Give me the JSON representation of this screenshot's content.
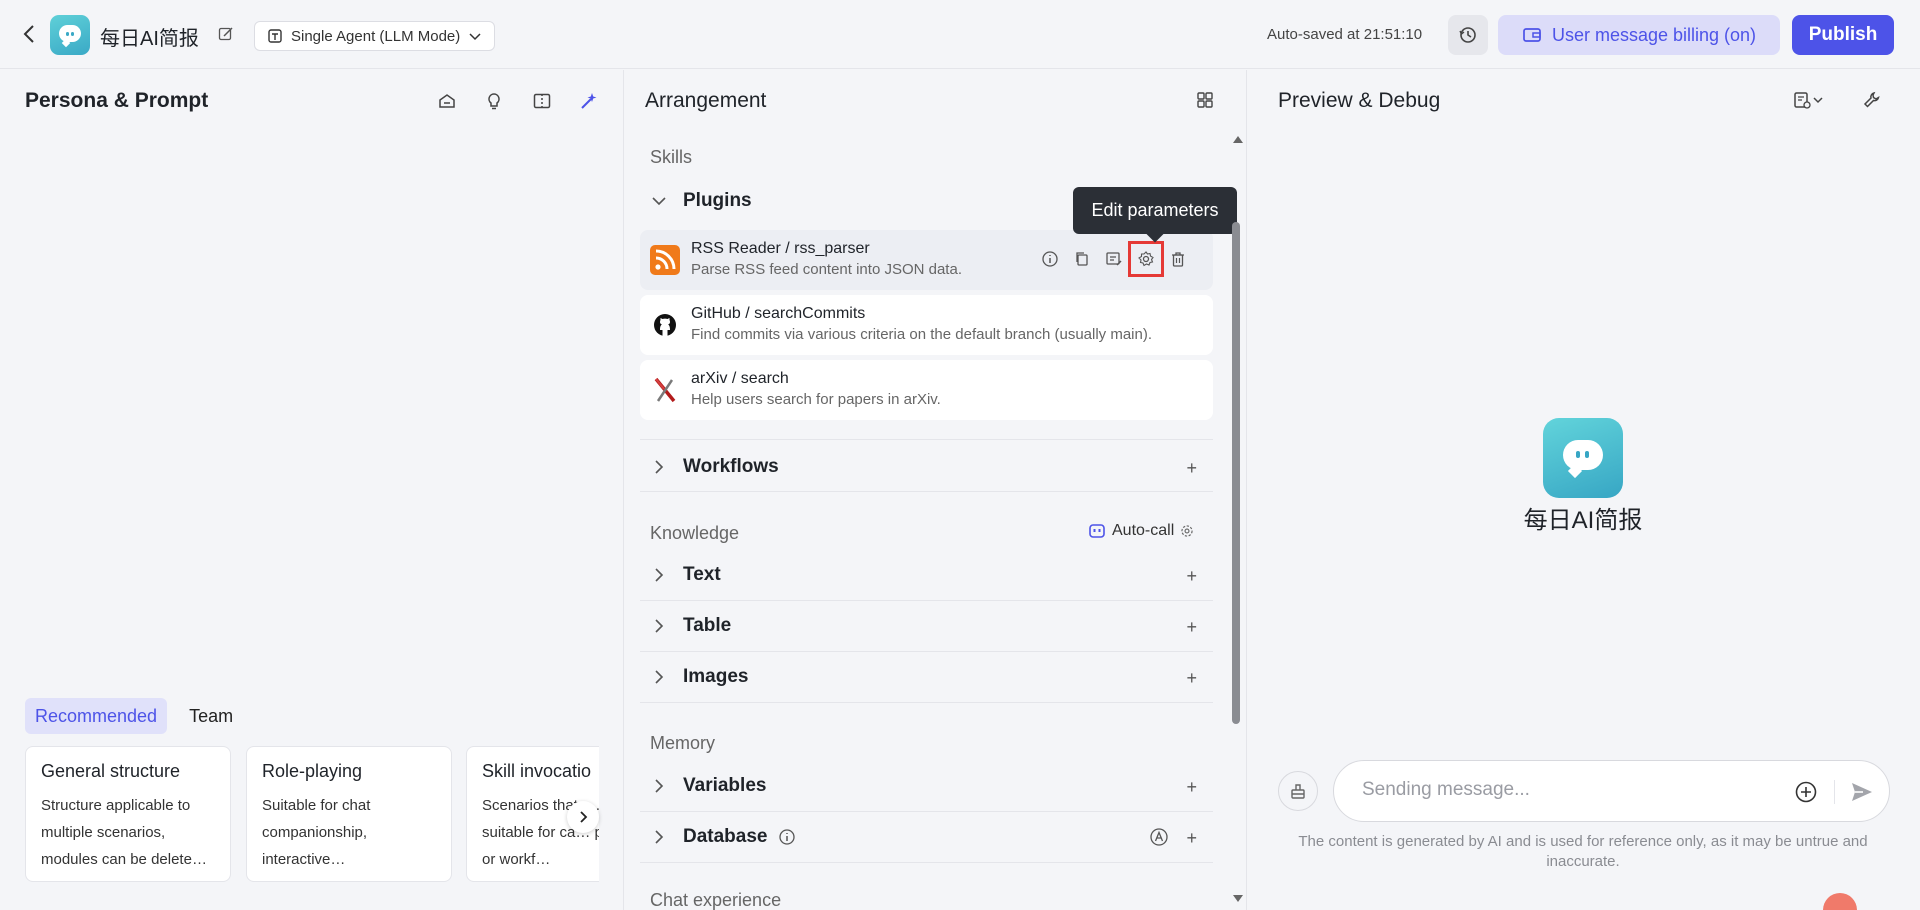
{
  "header": {
    "app_title": "每日AI简报",
    "mode_label": "Single Agent (LLM Mode)",
    "autosave_text": "Auto-saved at 21:51:10",
    "billing_label": "User message billing (on)",
    "publish_label": "Publish"
  },
  "left_panel": {
    "title": "Persona & Prompt",
    "tabs": [
      {
        "label": "Recommended",
        "active": true
      },
      {
        "label": "Team",
        "active": false
      }
    ],
    "cards": [
      {
        "title": "General structure",
        "desc": "Structure applicable to multiple scenarios, modules can be delete…"
      },
      {
        "title": "Role-playing",
        "desc": "Suitable for chat companionship, interactive…"
      },
      {
        "title": "Skill invocatio",
        "desc": "Scenarios that a… suitable for ca… plugins or workf…"
      }
    ]
  },
  "middle_panel": {
    "title": "Arrangement",
    "skills_label": "Skills",
    "plugins_label": "Plugins",
    "plugins": [
      {
        "name": "RSS Reader / rss_parser",
        "desc": "Parse RSS feed content into JSON data."
      },
      {
        "name": "GitHub / searchCommits",
        "desc": "Find commits via various criteria on the default branch (usually main)."
      },
      {
        "name": "arXiv / search",
        "desc": "Help users search for papers in arXiv."
      }
    ],
    "tooltip": "Edit parameters",
    "workflows_label": "Workflows",
    "knowledge_label": "Knowledge",
    "autocall_label": "Auto-call",
    "knowledge_items": [
      "Text",
      "Table",
      "Images"
    ],
    "memory_label": "Memory",
    "memory_items": [
      "Variables",
      "Database"
    ],
    "chat_experience_label": "Chat experience"
  },
  "right_panel": {
    "title": "Preview & Debug",
    "bot_name": "每日AI简报",
    "input_placeholder": "Sending message...",
    "disclaimer": "The content is generated by AI and is used for reference only, as it may be untrue and inaccurate."
  },
  "colors": {
    "accent": "#4d53e8",
    "highlight_box": "#e53935",
    "avatar_teal": "#37a6c4"
  }
}
